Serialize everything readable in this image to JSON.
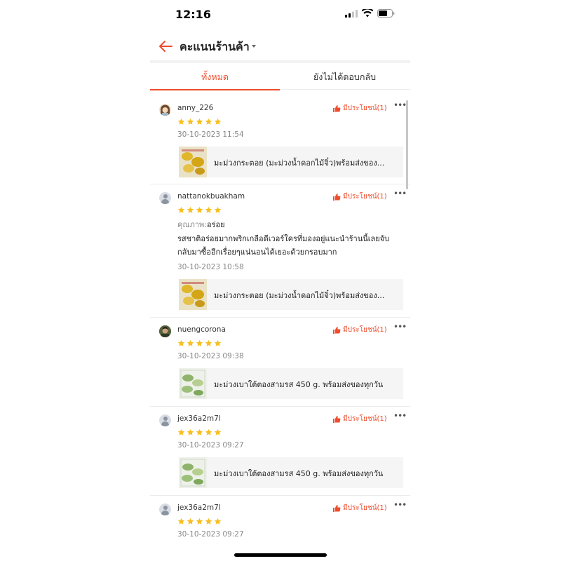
{
  "status_bar": {
    "time": "12:16"
  },
  "header": {
    "title": "คะแนนร้านค้า"
  },
  "tabs": [
    {
      "label": "ทั้งหมด",
      "active": true
    },
    {
      "label": "ยังไม่ได้ตอบกลับ",
      "active": false
    }
  ],
  "colors": {
    "accent": "#ee4d2d",
    "star": "#f6c022"
  },
  "reviews": [
    {
      "username": "anny_226",
      "helpful": "มีประโยชน์(1)",
      "rating": 5,
      "date": "30-10-2023 11:54",
      "product": "มะม่วงกระตอย (มะม่วงน้ำดอกไม้จิ๋ว)พร้อมส่งของ..."
    },
    {
      "username": "nattanokbuakham",
      "helpful": "มีประโยชน์(1)",
      "rating": 5,
      "quality_label": "คุณภาพ:",
      "quality_value": "อร่อย",
      "text_line1": "รสชาติอร่อยมากพริกเกลือดีเวอร์ใครที่มองอยู่แนะนำร้านนี้เลยจับ",
      "text_line2": "กลับมาซื้ออีกเรื่อยๆแน่นอนได้เยอะด้วยกรอบมาก",
      "date": "30-10-2023 10:58",
      "product": "มะม่วงกระตอย (มะม่วงน้ำดอกไม้จิ๋ว)พร้อมส่งของ..."
    },
    {
      "username": "nuengcorona",
      "helpful": "มีประโยชน์(1)",
      "rating": 5,
      "date": "30-10-2023 09:38",
      "product": "มะม่วงเบาใต้ตองสามรส 450 g. พร้อมส่งของทุกวัน"
    },
    {
      "username": "jex36a2m7l",
      "helpful": "มีประโยชน์(1)",
      "rating": 5,
      "date": "30-10-2023 09:27",
      "product": "มะม่วงเบาใต้ตองสามรส 450 g. พร้อมส่งของทุกวัน"
    },
    {
      "username": "jex36a2m7l",
      "helpful": "มีประโยชน์(1)",
      "rating": 5,
      "date": "30-10-2023 09:27"
    }
  ]
}
